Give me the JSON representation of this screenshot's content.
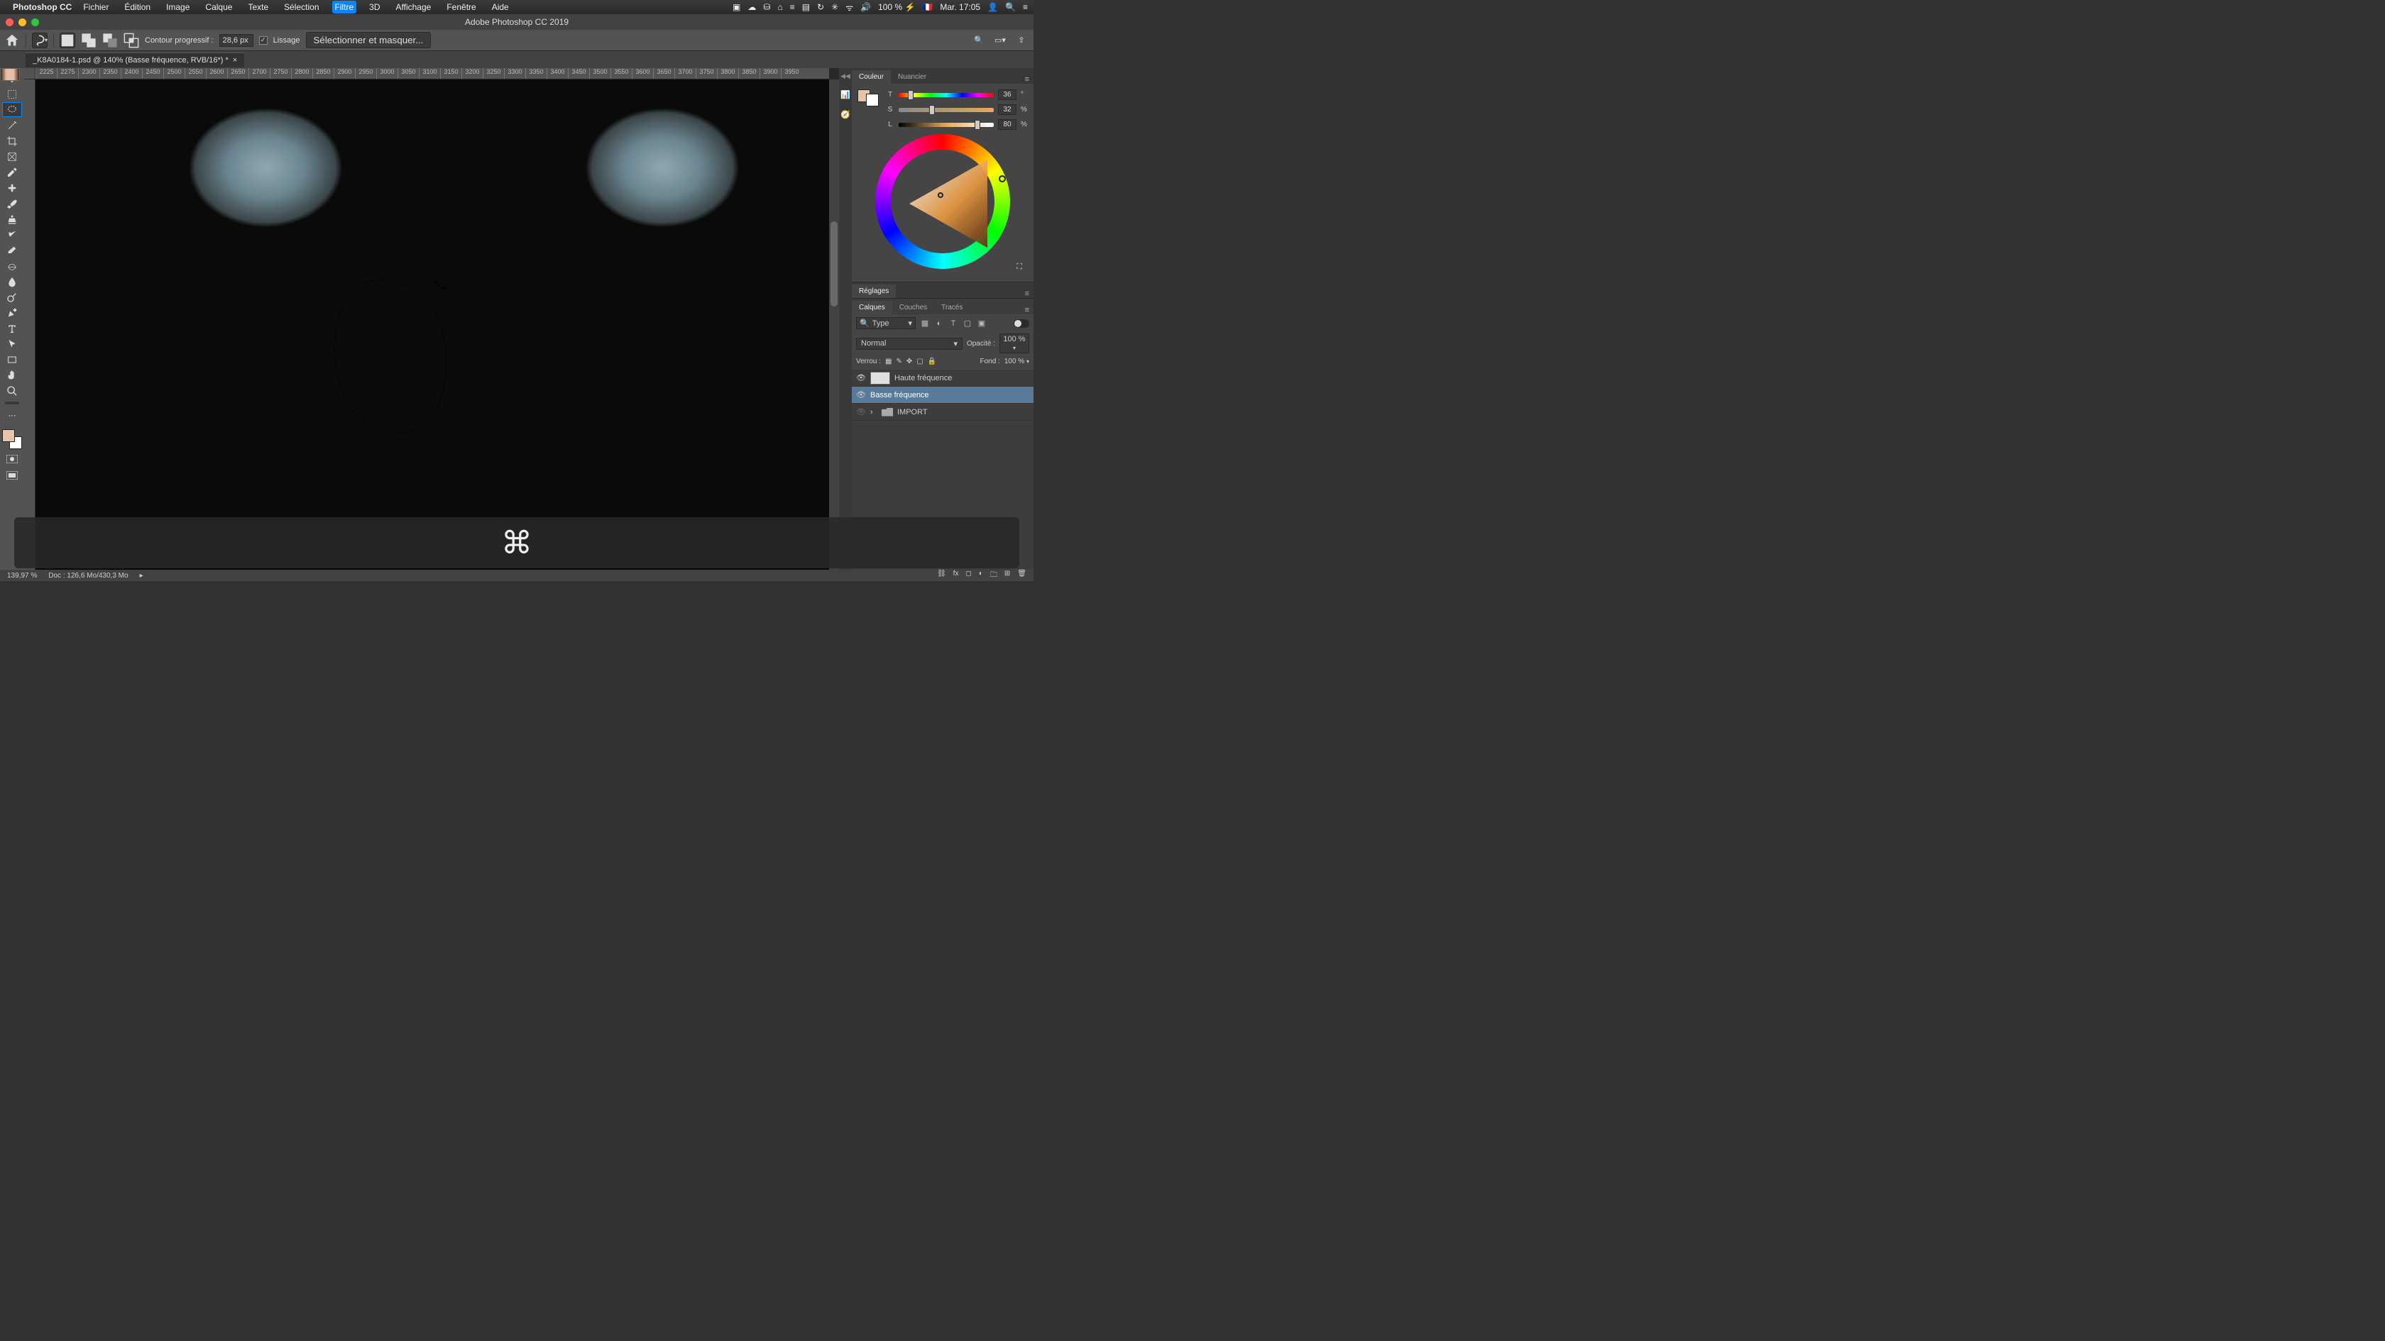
{
  "menubar": {
    "app_name": "Photoshop CC",
    "items": [
      "Fichier",
      "Édition",
      "Image",
      "Calque",
      "Texte",
      "Sélection",
      "Filtre",
      "3D",
      "Affichage",
      "Fenêtre",
      "Aide"
    ],
    "active_index": 6,
    "battery": "100 % ⚡",
    "flag": "🇫🇷",
    "datetime": "Mar. 17:05"
  },
  "window": {
    "title": "Adobe Photoshop CC 2019"
  },
  "options": {
    "feather_label": "Contour progressif :",
    "feather_value": "28,6 px",
    "antialias_label": "Lissage",
    "select_mask_label": "Sélectionner et masquer..."
  },
  "document": {
    "tab_title": "_K8A0184-1.psd @ 140% (Basse fréquence, RVB/16*) *"
  },
  "ruler_ticks": [
    "2225",
    "2275",
    "2300",
    "2350",
    "2400",
    "2450",
    "2500",
    "2550",
    "2600",
    "2650",
    "2700",
    "2750",
    "2800",
    "2850",
    "2900",
    "2950",
    "3000",
    "3050",
    "3100",
    "3150",
    "3200",
    "3250",
    "3300",
    "3350",
    "3400",
    "3450",
    "3500",
    "3550",
    "3600",
    "3650",
    "3700",
    "3750",
    "3800",
    "3850",
    "3900",
    "3950"
  ],
  "color_panel": {
    "tabs": [
      "Couleur",
      "Nuancier"
    ],
    "hsl": {
      "T": 36,
      "S": 32,
      "L": 80
    },
    "sliders": [
      {
        "label": "T",
        "unit": "°"
      },
      {
        "label": "S",
        "unit": "%"
      },
      {
        "label": "L",
        "unit": "%"
      }
    ]
  },
  "reglages_panel": {
    "title": "Réglages"
  },
  "layers_panel": {
    "tabs": [
      "Calques",
      "Couches",
      "Tracés"
    ],
    "filter_placeholder": "Type",
    "blend_mode": "Normal",
    "opacity_label": "Opacité :",
    "opacity_value": "100 %",
    "lock_label": "Verrou :",
    "fill_label": "Fond :",
    "fill_value": "100 %",
    "layers": [
      {
        "name": "Haute fréquence",
        "visible": true,
        "selected": false,
        "thumb": "white"
      },
      {
        "name": "Basse fréquence",
        "visible": true,
        "selected": true,
        "thumb": "photo"
      },
      {
        "name": "IMPORT",
        "visible": false,
        "selected": false,
        "is_group": true
      }
    ]
  },
  "keystroke": "⌘",
  "status": {
    "zoom": "139,97 %",
    "doc": "Doc : 126,6 Mo/430,3 Mo"
  }
}
